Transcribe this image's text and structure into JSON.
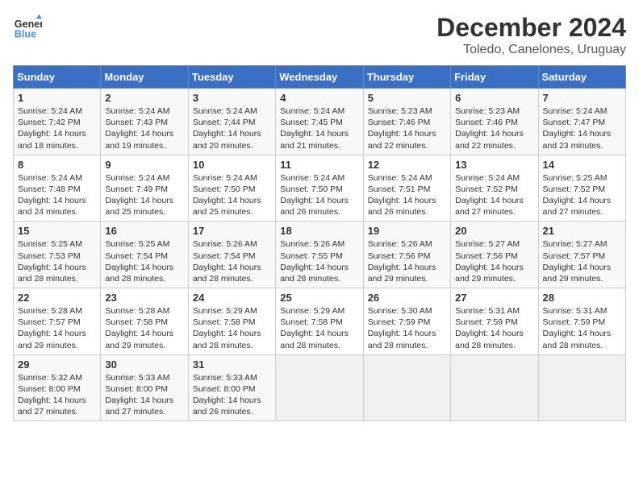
{
  "header": {
    "logo_line1": "General",
    "logo_line2": "Blue",
    "month": "December 2024",
    "location": "Toledo, Canelones, Uruguay"
  },
  "days_of_week": [
    "Sunday",
    "Monday",
    "Tuesday",
    "Wednesday",
    "Thursday",
    "Friday",
    "Saturday"
  ],
  "weeks": [
    [
      {
        "day": "1",
        "sunrise": "Sunrise: 5:24 AM",
        "sunset": "Sunset: 7:42 PM",
        "daylight": "Daylight: 14 hours and 18 minutes."
      },
      {
        "day": "2",
        "sunrise": "Sunrise: 5:24 AM",
        "sunset": "Sunset: 7:43 PM",
        "daylight": "Daylight: 14 hours and 19 minutes."
      },
      {
        "day": "3",
        "sunrise": "Sunrise: 5:24 AM",
        "sunset": "Sunset: 7:44 PM",
        "daylight": "Daylight: 14 hours and 20 minutes."
      },
      {
        "day": "4",
        "sunrise": "Sunrise: 5:24 AM",
        "sunset": "Sunset: 7:45 PM",
        "daylight": "Daylight: 14 hours and 21 minutes."
      },
      {
        "day": "5",
        "sunrise": "Sunrise: 5:23 AM",
        "sunset": "Sunset: 7:46 PM",
        "daylight": "Daylight: 14 hours and 22 minutes."
      },
      {
        "day": "6",
        "sunrise": "Sunrise: 5:23 AM",
        "sunset": "Sunset: 7:46 PM",
        "daylight": "Daylight: 14 hours and 22 minutes."
      },
      {
        "day": "7",
        "sunrise": "Sunrise: 5:24 AM",
        "sunset": "Sunset: 7:47 PM",
        "daylight": "Daylight: 14 hours and 23 minutes."
      }
    ],
    [
      {
        "day": "8",
        "sunrise": "Sunrise: 5:24 AM",
        "sunset": "Sunset: 7:48 PM",
        "daylight": "Daylight: 14 hours and 24 minutes."
      },
      {
        "day": "9",
        "sunrise": "Sunrise: 5:24 AM",
        "sunset": "Sunset: 7:49 PM",
        "daylight": "Daylight: 14 hours and 25 minutes."
      },
      {
        "day": "10",
        "sunrise": "Sunrise: 5:24 AM",
        "sunset": "Sunset: 7:50 PM",
        "daylight": "Daylight: 14 hours and 25 minutes."
      },
      {
        "day": "11",
        "sunrise": "Sunrise: 5:24 AM",
        "sunset": "Sunset: 7:50 PM",
        "daylight": "Daylight: 14 hours and 26 minutes."
      },
      {
        "day": "12",
        "sunrise": "Sunrise: 5:24 AM",
        "sunset": "Sunset: 7:51 PM",
        "daylight": "Daylight: 14 hours and 26 minutes."
      },
      {
        "day": "13",
        "sunrise": "Sunrise: 5:24 AM",
        "sunset": "Sunset: 7:52 PM",
        "daylight": "Daylight: 14 hours and 27 minutes."
      },
      {
        "day": "14",
        "sunrise": "Sunrise: 5:25 AM",
        "sunset": "Sunset: 7:52 PM",
        "daylight": "Daylight: 14 hours and 27 minutes."
      }
    ],
    [
      {
        "day": "15",
        "sunrise": "Sunrise: 5:25 AM",
        "sunset": "Sunset: 7:53 PM",
        "daylight": "Daylight: 14 hours and 28 minutes."
      },
      {
        "day": "16",
        "sunrise": "Sunrise: 5:25 AM",
        "sunset": "Sunset: 7:54 PM",
        "daylight": "Daylight: 14 hours and 28 minutes."
      },
      {
        "day": "17",
        "sunrise": "Sunrise: 5:26 AM",
        "sunset": "Sunset: 7:54 PM",
        "daylight": "Daylight: 14 hours and 28 minutes."
      },
      {
        "day": "18",
        "sunrise": "Sunrise: 5:26 AM",
        "sunset": "Sunset: 7:55 PM",
        "daylight": "Daylight: 14 hours and 28 minutes."
      },
      {
        "day": "19",
        "sunrise": "Sunrise: 5:26 AM",
        "sunset": "Sunset: 7:56 PM",
        "daylight": "Daylight: 14 hours and 29 minutes."
      },
      {
        "day": "20",
        "sunrise": "Sunrise: 5:27 AM",
        "sunset": "Sunset: 7:56 PM",
        "daylight": "Daylight: 14 hours and 29 minutes."
      },
      {
        "day": "21",
        "sunrise": "Sunrise: 5:27 AM",
        "sunset": "Sunset: 7:57 PM",
        "daylight": "Daylight: 14 hours and 29 minutes."
      }
    ],
    [
      {
        "day": "22",
        "sunrise": "Sunrise: 5:28 AM",
        "sunset": "Sunset: 7:57 PM",
        "daylight": "Daylight: 14 hours and 29 minutes."
      },
      {
        "day": "23",
        "sunrise": "Sunrise: 5:28 AM",
        "sunset": "Sunset: 7:58 PM",
        "daylight": "Daylight: 14 hours and 29 minutes."
      },
      {
        "day": "24",
        "sunrise": "Sunrise: 5:29 AM",
        "sunset": "Sunset: 7:58 PM",
        "daylight": "Daylight: 14 hours and 28 minutes."
      },
      {
        "day": "25",
        "sunrise": "Sunrise: 5:29 AM",
        "sunset": "Sunset: 7:58 PM",
        "daylight": "Daylight: 14 hours and 28 minutes."
      },
      {
        "day": "26",
        "sunrise": "Sunrise: 5:30 AM",
        "sunset": "Sunset: 7:59 PM",
        "daylight": "Daylight: 14 hours and 28 minutes."
      },
      {
        "day": "27",
        "sunrise": "Sunrise: 5:31 AM",
        "sunset": "Sunset: 7:59 PM",
        "daylight": "Daylight: 14 hours and 28 minutes."
      },
      {
        "day": "28",
        "sunrise": "Sunrise: 5:31 AM",
        "sunset": "Sunset: 7:59 PM",
        "daylight": "Daylight: 14 hours and 28 minutes."
      }
    ],
    [
      {
        "day": "29",
        "sunrise": "Sunrise: 5:32 AM",
        "sunset": "Sunset: 8:00 PM",
        "daylight": "Daylight: 14 hours and 27 minutes."
      },
      {
        "day": "30",
        "sunrise": "Sunrise: 5:33 AM",
        "sunset": "Sunset: 8:00 PM",
        "daylight": "Daylight: 14 hours and 27 minutes."
      },
      {
        "day": "31",
        "sunrise": "Sunrise: 5:33 AM",
        "sunset": "Sunset: 8:00 PM",
        "daylight": "Daylight: 14 hours and 26 minutes."
      },
      null,
      null,
      null,
      null
    ]
  ]
}
